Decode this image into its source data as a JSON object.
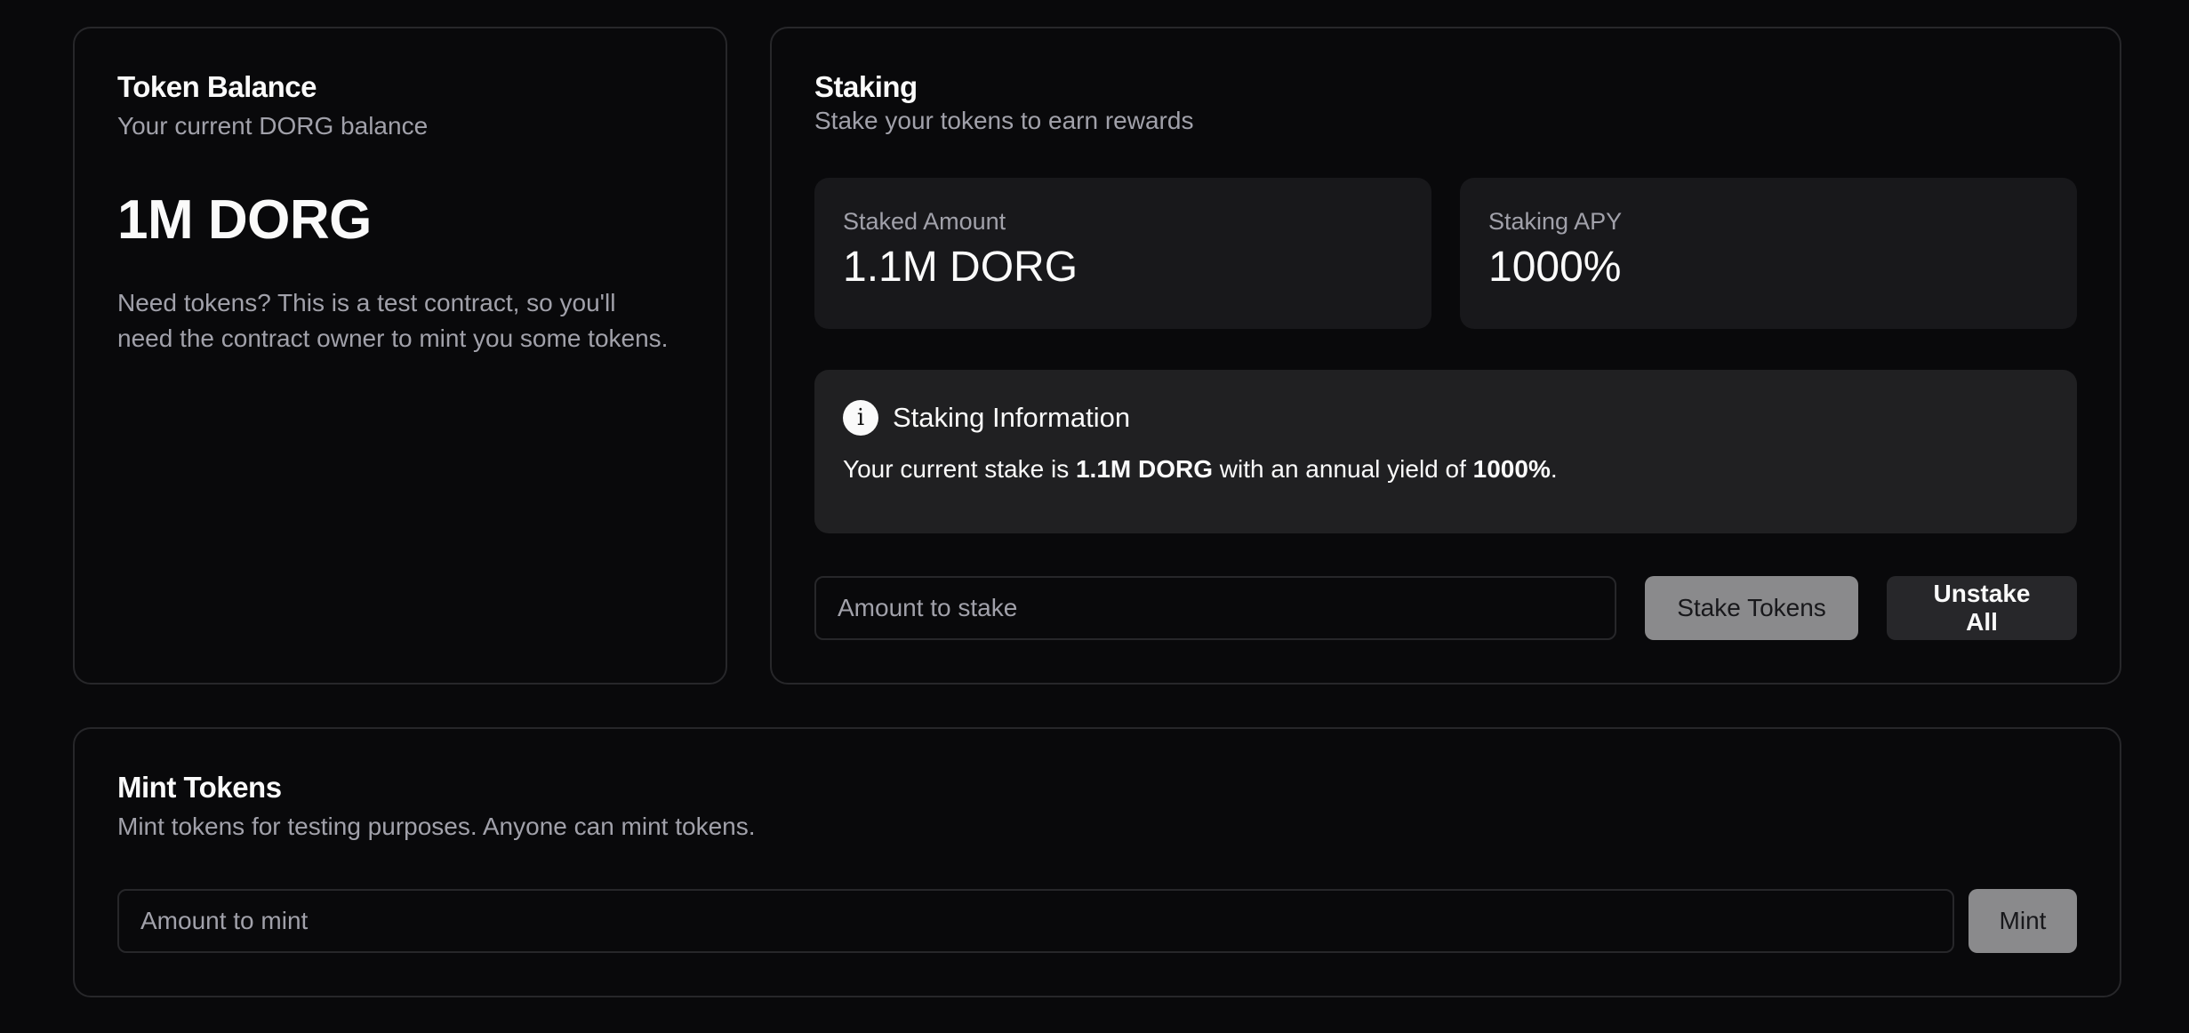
{
  "balance": {
    "title": "Token Balance",
    "description": "Your current DORG balance",
    "amount": "1M DORG",
    "hint": "Need tokens? This is a test contract, so you'll need the contract owner to mint you some tokens."
  },
  "staking": {
    "title": "Staking",
    "description": "Stake your tokens to earn rewards",
    "staked_label": "Staked Amount",
    "staked_value": "1.1M DORG",
    "apy_label": "Staking APY",
    "apy_value": "1000%",
    "info": {
      "icon": "info-icon",
      "icon_glyph": "i",
      "title": "Staking Information",
      "text_prefix": "Your current stake is ",
      "stake_amount": "1.1M DORG",
      "text_middle": " with an annual yield of ",
      "yield": "1000%",
      "text_suffix": "."
    },
    "input_placeholder": "Amount to stake",
    "stake_button": "Stake Tokens",
    "unstake_button": "Unstake All"
  },
  "mint": {
    "title": "Mint Tokens",
    "description": "Mint tokens for testing purposes. Anyone can mint tokens.",
    "input_placeholder": "Amount to mint",
    "button": "Mint"
  }
}
